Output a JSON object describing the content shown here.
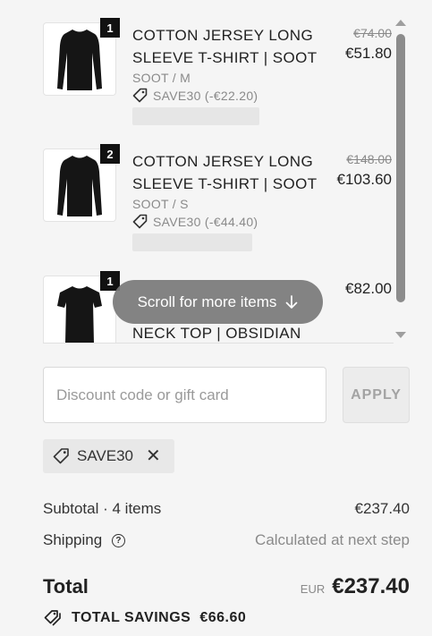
{
  "items": [
    {
      "quantity": "1",
      "title": "COTTON JERSEY LONG SLEEVE T-SHIRT | SOOT",
      "variant": "SOOT / M",
      "discount": "SAVE30 (-€22.20)",
      "original_price": "€74.00",
      "price": "€51.80",
      "image_icon": "long-sleeve-shirt-icon"
    },
    {
      "quantity": "2",
      "title": "COTTON JERSEY LONG SLEEVE T-SHIRT | SOOT",
      "variant": "SOOT / S",
      "discount": "SAVE30 (-€44.40)",
      "original_price": "€148.00",
      "price": "€103.60",
      "image_icon": "long-sleeve-shirt-icon"
    },
    {
      "quantity": "1",
      "title": "NECK TOP | OBSIDIAN",
      "price": "€82.00",
      "image_icon": "short-sleeve-top-icon"
    }
  ],
  "scroll_hint": "Scroll for more items",
  "discount_field": {
    "placeholder": "Discount code or gift card",
    "value": ""
  },
  "apply_label": "APPLY",
  "applied_code": "SAVE30",
  "summary": {
    "subtotal_label": "Subtotal · 4 items",
    "subtotal_value": "€237.40",
    "shipping_label": "Shipping",
    "shipping_value": "Calculated at next step",
    "total_label": "Total",
    "currency": "EUR",
    "total_value": "€237.40",
    "savings_label": "TOTAL SAVINGS",
    "savings_value": "€66.60"
  },
  "colors": {
    "background": "#f5f5f5",
    "qty_badge": "#111111",
    "chip": "#e8e8e8",
    "hint_pill": "#787878"
  }
}
